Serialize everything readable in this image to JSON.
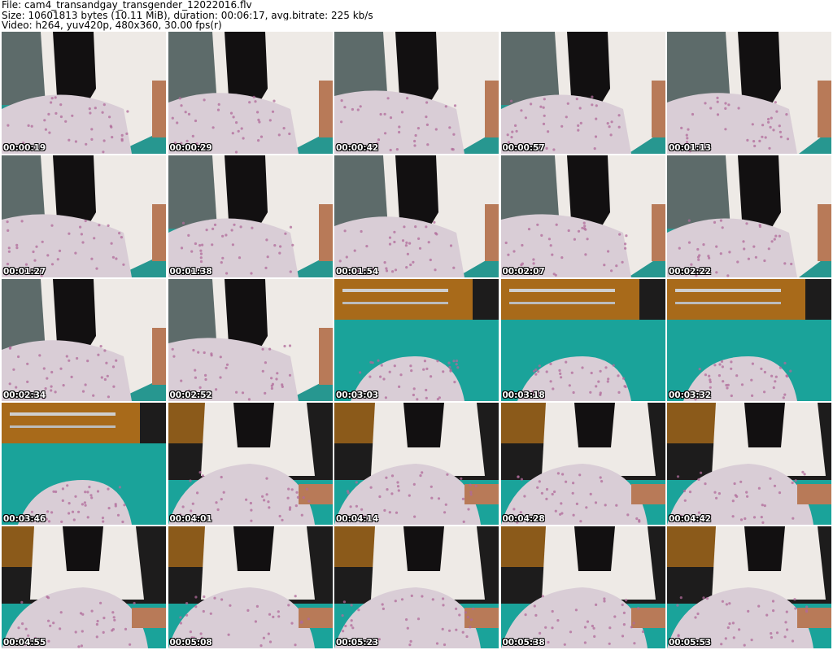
{
  "header": {
    "file_line": "File: cam4_transandgay_transgender_12022016.flv",
    "size_line": "Size: 10601813 bytes (10.11 MiB), duration: 00:06:17, avg.bitrate: 225 kb/s",
    "video_line": "Video: h264, yuv420p, 480x360, 30.00 fps(r)"
  },
  "colors": {
    "sheet_teal": "#1aa39a",
    "pillow": "#d9cdd6",
    "pillow_dots": "#b06a9a",
    "nightgown": "#eeeae6",
    "hair": "#121011",
    "skin": "#b87a58",
    "headboard": "#a86a1a",
    "wall_dark": "#1d1c1c",
    "timestamp_text": "#ffffff"
  },
  "thumbnails": [
    {
      "time": "00:00:19",
      "scene": "close"
    },
    {
      "time": "00:00:29",
      "scene": "close"
    },
    {
      "time": "00:00:42",
      "scene": "close"
    },
    {
      "time": "00:00:57",
      "scene": "close"
    },
    {
      "time": "00:01:13",
      "scene": "close"
    },
    {
      "time": "00:01:27",
      "scene": "close"
    },
    {
      "time": "00:01:38",
      "scene": "close"
    },
    {
      "time": "00:01:54",
      "scene": "close"
    },
    {
      "time": "00:02:07",
      "scene": "close"
    },
    {
      "time": "00:02:22",
      "scene": "close"
    },
    {
      "time": "00:02:34",
      "scene": "close"
    },
    {
      "time": "00:02:52",
      "scene": "close"
    },
    {
      "time": "00:03:03",
      "scene": "bed"
    },
    {
      "time": "00:03:18",
      "scene": "bed"
    },
    {
      "time": "00:03:32",
      "scene": "bed"
    },
    {
      "time": "00:03:46",
      "scene": "bed"
    },
    {
      "time": "00:04:01",
      "scene": "seated"
    },
    {
      "time": "00:04:14",
      "scene": "seated"
    },
    {
      "time": "00:04:28",
      "scene": "seated"
    },
    {
      "time": "00:04:42",
      "scene": "seated"
    },
    {
      "time": "00:04:55",
      "scene": "seated"
    },
    {
      "time": "00:05:08",
      "scene": "seated"
    },
    {
      "time": "00:05:23",
      "scene": "seated"
    },
    {
      "time": "00:05:38",
      "scene": "seated"
    },
    {
      "time": "00:05:53",
      "scene": "seated"
    }
  ]
}
